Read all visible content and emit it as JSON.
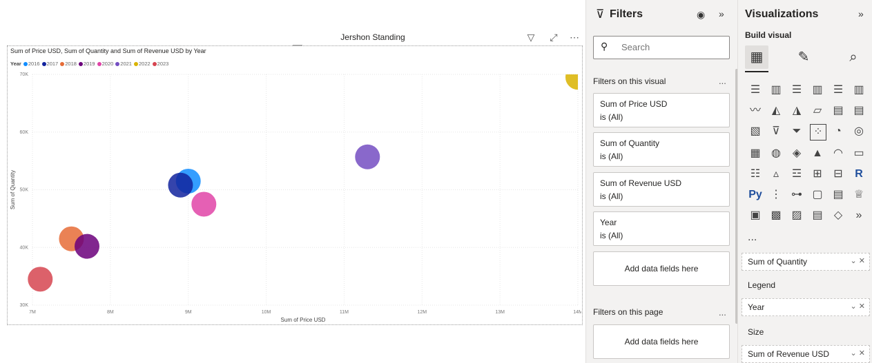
{
  "report": {
    "title": "Jershon Standing"
  },
  "visual": {
    "title": "Sum of Price USD, Sum of Quantity and Sum of Revenue USD by Year",
    "legend_title": "Year",
    "legend_items": [
      {
        "label": "2016",
        "color": "#118DFF"
      },
      {
        "label": "2017",
        "color": "#12239E"
      },
      {
        "label": "2018",
        "color": "#E66C37"
      },
      {
        "label": "2019",
        "color": "#6B007B"
      },
      {
        "label": "2020",
        "color": "#E044A7"
      },
      {
        "label": "2021",
        "color": "#744EC2"
      },
      {
        "label": "2022",
        "color": "#D9B300"
      },
      {
        "label": "2023",
        "color": "#D64550"
      }
    ]
  },
  "chart_data": {
    "type": "scatter",
    "title": "Sum of Price USD, Sum of Quantity and Sum of Revenue USD by Year",
    "xlabel": "Sum of Price USD",
    "ylabel": "Sum of Quantity",
    "xlim": [
      7000000,
      14000000
    ],
    "ylim": [
      30000,
      70000
    ],
    "x_ticks": [
      "7M",
      "8M",
      "9M",
      "10M",
      "11M",
      "12M",
      "13M",
      "14M"
    ],
    "y_ticks": [
      "30K",
      "40K",
      "50K",
      "60K",
      "70K"
    ],
    "grid": true,
    "legend": "top-left",
    "points": [
      {
        "year": "2016",
        "x": 9000000,
        "y": 51500,
        "color": "#118DFF"
      },
      {
        "year": "2017",
        "x": 8900000,
        "y": 50800,
        "color": "#12239E"
      },
      {
        "year": "2018",
        "x": 7500000,
        "y": 41500,
        "color": "#E66C37"
      },
      {
        "year": "2019",
        "x": 7700000,
        "y": 40200,
        "color": "#6B007B"
      },
      {
        "year": "2020",
        "x": 9200000,
        "y": 47500,
        "color": "#E044A7"
      },
      {
        "year": "2021",
        "x": 11300000,
        "y": 55700,
        "color": "#744EC2"
      },
      {
        "year": "2022",
        "x": 14000000,
        "y": 69500,
        "color": "#D9B300"
      },
      {
        "year": "2023",
        "x": 7100000,
        "y": 34500,
        "color": "#D64550"
      }
    ]
  },
  "filters": {
    "title": "Filters",
    "search_placeholder": "Search",
    "on_visual_label": "Filters on this visual",
    "on_page_label": "Filters on this page",
    "more": "...",
    "cards": [
      {
        "name": "Sum of Price USD",
        "state": "is (All)"
      },
      {
        "name": "Sum of Quantity",
        "state": "is (All)"
      },
      {
        "name": "Sum of Revenue USD",
        "state": "is (All)"
      },
      {
        "name": "Year",
        "state": "is (All)"
      }
    ],
    "add_fields": "Add data fields here"
  },
  "visualizations": {
    "title": "Visualizations",
    "build_label": "Build visual",
    "more": "...",
    "wells": {
      "y_value": "Sum of Quantity",
      "legend_label": "Legend",
      "legend_value": "Year",
      "size_label": "Size",
      "size_value": "Sum of Revenue USD"
    }
  }
}
